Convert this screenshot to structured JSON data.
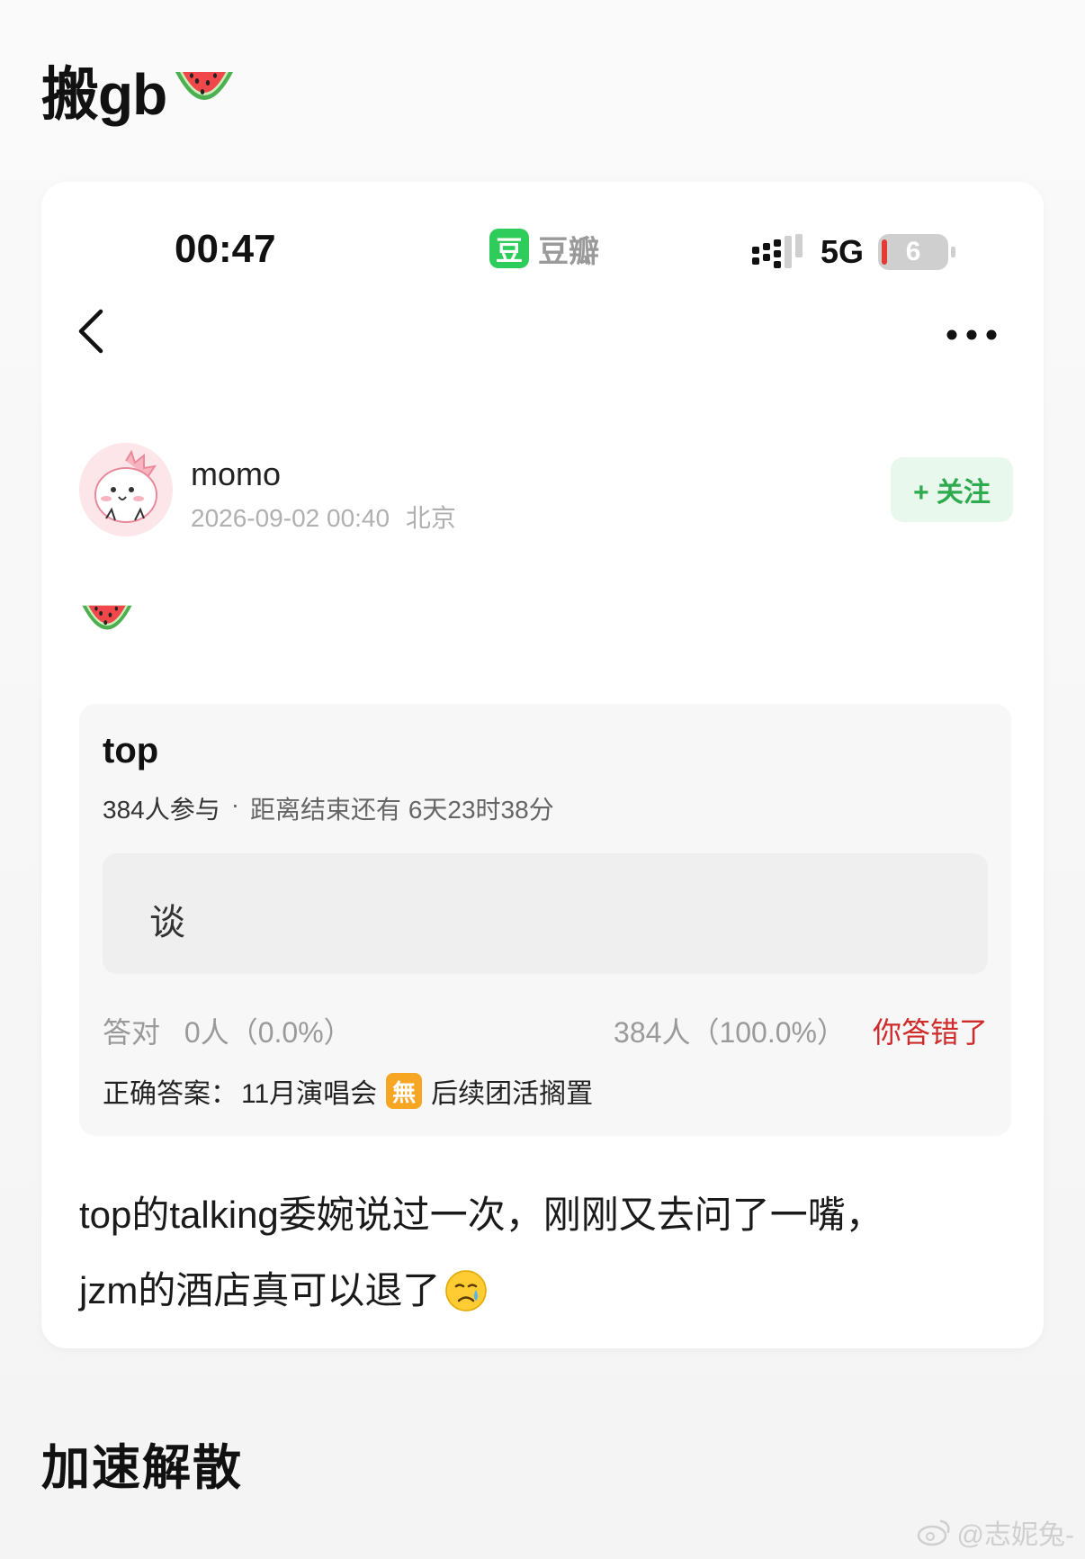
{
  "post_title": {
    "text": "搬gb",
    "emoji": "watermelon-emoji"
  },
  "statusbar": {
    "time": "00:47",
    "app_icon_char": "豆",
    "app_name": "豆瓣",
    "network": "5G",
    "battery": "6",
    "battery_low_color": "#e53935"
  },
  "navbar": {
    "back_icon": "chevron-left-icon",
    "more_icon": "more-dots-icon"
  },
  "author": {
    "name": "momo",
    "timestamp": "2026-09-02 00:40",
    "location": "北京",
    "follow_label": "+ 关注"
  },
  "post_emoji": "watermelon-emoji",
  "quiz": {
    "title": "top",
    "participants": "384人参与",
    "separator": "·",
    "time_left": "距离结束还有 6天23时38分",
    "option": "谈",
    "correct_label": "答对",
    "correct_count": "0人（0.0%）",
    "wrong_count": "384人（100.0%）",
    "wrong_label": "你答错了",
    "answer_prefix": "正确答案：",
    "answer_main": "11月演唱会",
    "answer_badge": "無",
    "answer_suffix": "后续团活搁置"
  },
  "body": {
    "line1": "top的talking委婉说过一次，刚刚又去问了一嘴，",
    "line2": "jzm的酒店真可以退了",
    "emoji": "crying-face-emoji"
  },
  "caption": "加速解散",
  "watermark": "@志妮兔-",
  "colors": {
    "brand_green": "#2ecc5a",
    "follow_bg": "#e9f8ec",
    "follow_text": "#2eaa4f",
    "wrong_red": "#cf2b2b",
    "badge_orange": "#f6a623"
  }
}
